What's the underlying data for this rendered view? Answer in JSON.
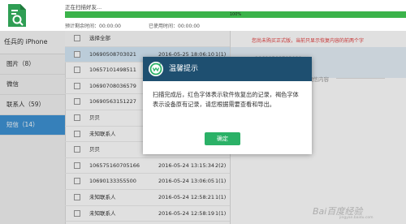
{
  "progress": {
    "label": "正在扫描好友...",
    "percent_text": "100%",
    "percent_value": 100,
    "estimated_time": "预计剩余时间：00:00:00",
    "used_time": "已使用时间：00:00:00"
  },
  "sidebar": {
    "device": "任兵的 iPhone",
    "items": [
      {
        "label": "图片（8）"
      },
      {
        "label": "微信"
      },
      {
        "label": "联系人（59）"
      },
      {
        "label": "短信（14）"
      }
    ]
  },
  "list": {
    "select_all": "选择全部",
    "rows": [
      {
        "number": "10690508703021",
        "date": "2016-05-25 18:06:10",
        "count": "1(1)"
      },
      {
        "number": "10657101498511",
        "date": "",
        "count": ""
      },
      {
        "number": "10690708036579",
        "date": "",
        "count": ""
      },
      {
        "number": "10690563151227",
        "date": "",
        "count": ""
      },
      {
        "number": "贝贝",
        "date": "",
        "count": ""
      },
      {
        "number": "未知联系人",
        "date": "",
        "count": ""
      },
      {
        "number": "贝贝",
        "date": "",
        "count": ""
      },
      {
        "number": "10657516070516​6",
        "date": "2016-05-24 13:15:34",
        "count": "2(2)"
      },
      {
        "number": "10690133355500",
        "date": "2016-05-24 13:06:05",
        "count": "1(1)"
      },
      {
        "number": "未知联系人",
        "date": "2016-05-24 12:58:21",
        "count": "1(1)"
      },
      {
        "number": "未知联系人",
        "date": "2016-05-24 12:58:19",
        "count": "1(1)"
      }
    ]
  },
  "detail": {
    "notice": "您尚未购买正式版，当前只显示恢复内容的前两个字",
    "contact": "10690508703021",
    "section_label": "短信内容"
  },
  "dialog": {
    "title": "温馨提示",
    "body": "扫描完成后，红色字体表示软件恢复出的记录，褐色字体表示设备原有记录，请您根据需要查看和导出。",
    "ok_label": "确定"
  },
  "watermark": {
    "text": "Bai百度经验",
    "sub": "jingyan.baidu.com"
  },
  "colors": {
    "progress_fill": "#3bb34a",
    "sidebar_active": "#3e92d4",
    "dialog_header": "#1e4f70",
    "dialog_button": "#2bb167",
    "notice_text": "#e23b3b",
    "row_highlight": "#d5e9f8"
  }
}
